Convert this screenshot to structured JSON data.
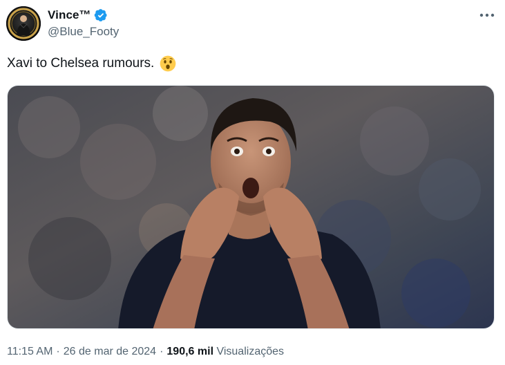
{
  "author": {
    "display_name": "Vince™",
    "handle": "@Blue_Footy",
    "verified_icon": "verified-badge-icon",
    "avatar_icon": "avatar-image"
  },
  "tweet": {
    "text": "Xavi to Chelsea rumours.",
    "emoji": "hushed-face-emoji"
  },
  "menu": {
    "icon": "more-options-icon"
  },
  "media": {
    "alt": "photo-of-manager-shouting"
  },
  "meta": {
    "time": "11:15 AM",
    "separator": "·",
    "date": "26 de mar de 2024",
    "views_count": "190,6 mil",
    "views_label": "Visualizações"
  },
  "colors": {
    "verified": "#1d9bf0",
    "secondary_text": "#536471",
    "primary_text": "#0f1419"
  }
}
